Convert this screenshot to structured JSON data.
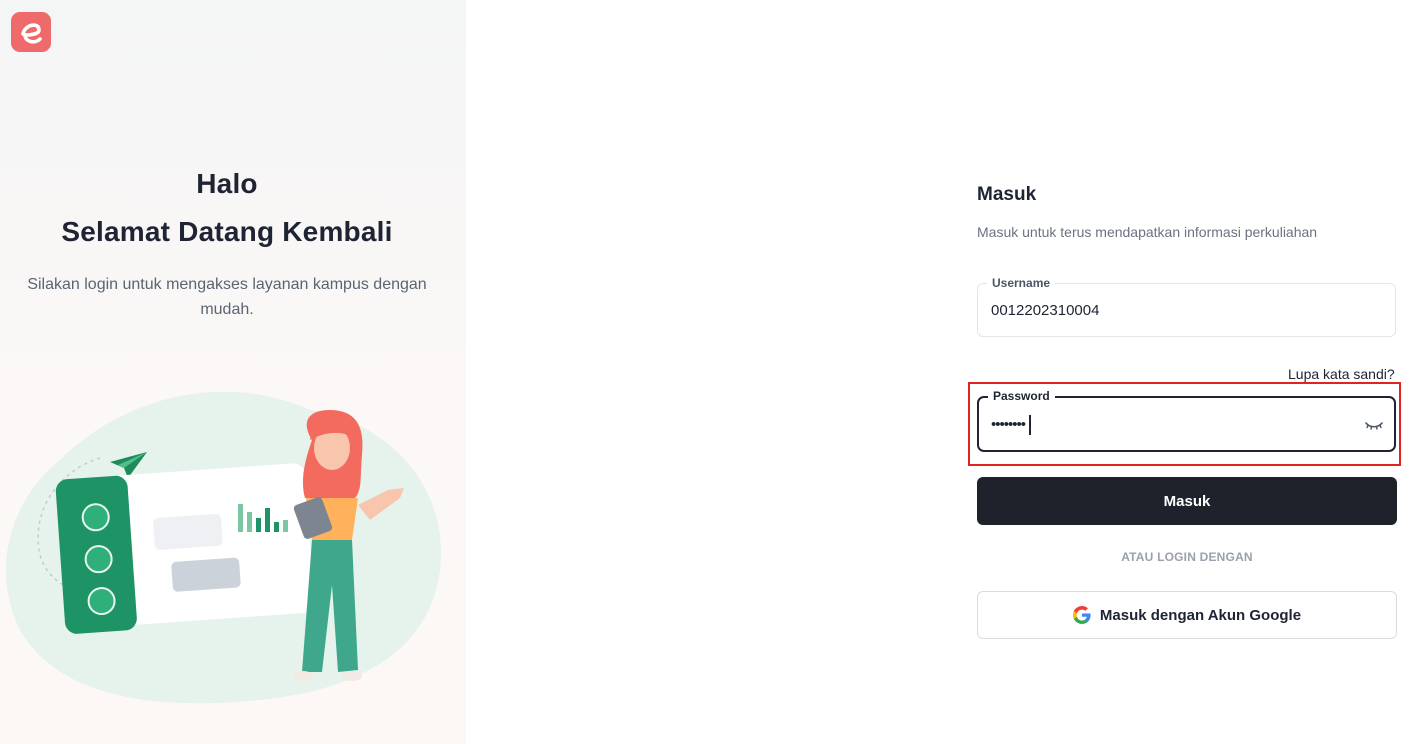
{
  "brand": {
    "logo_letter": "e",
    "color": "#ef6b6b"
  },
  "hero": {
    "greeting": "Halo",
    "welcome": "Selamat Datang Kembali",
    "subtitle": "Silakan login untuk mengakses layanan kampus dengan mudah."
  },
  "login": {
    "title": "Masuk",
    "subtitle": "Masuk untuk terus mendapatkan informasi perkuliahan",
    "username": {
      "label": "Username",
      "value": "0012202310004"
    },
    "forgot_label": "Lupa kata sandi?",
    "password": {
      "label": "Password",
      "masked_value": "••••••••"
    },
    "submit_label": "Masuk",
    "divider_label": "ATAU LOGIN DENGAN",
    "google_label": "Masuk dengan Akun Google"
  },
  "colors": {
    "primary_button": "#1e232b",
    "highlight_border": "#e02424",
    "text_dark": "#1e2433"
  }
}
